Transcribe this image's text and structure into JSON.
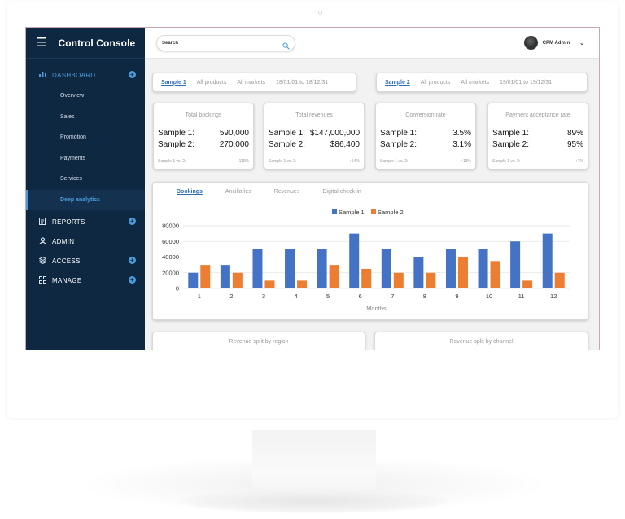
{
  "app": {
    "title": "Control Console"
  },
  "sidebar": {
    "sections": [
      {
        "label": "DASHBOARD",
        "icon": "bar-chart-icon",
        "active": true,
        "expand": true
      },
      {
        "label": "REPORTS",
        "icon": "document-icon",
        "active": false,
        "expand": true
      },
      {
        "label": "ADMIN",
        "icon": "user-icon",
        "active": false,
        "expand": false
      },
      {
        "label": "ACCESS",
        "icon": "layers-icon",
        "active": false,
        "expand": true
      },
      {
        "label": "MANAGE",
        "icon": "grid-icon",
        "active": false,
        "expand": true
      }
    ],
    "dashboard_items": [
      "Overview",
      "Sales",
      "Promotion",
      "Payments",
      "Services",
      "Deep analytics"
    ],
    "active_item": "Deep analytics"
  },
  "topbar": {
    "search_placeholder": "Search",
    "user_name": "CPM Admin"
  },
  "filters": [
    {
      "sample": "Sample 1",
      "products": "All products",
      "markets": "All markets",
      "range": "18/01/01 to 18/12/31"
    },
    {
      "sample": "Sample 2",
      "products": "All products",
      "markets": "All markets",
      "range": "19/01/01 to 19/12/31"
    }
  ],
  "kpis": [
    {
      "title": "Total bookings",
      "s1_label": "Sample 1:",
      "s1": "590,000",
      "s2_label": "Sample 2:",
      "s2": "270,000",
      "cmp_label": "Sample 1 vs. 2:",
      "cmp": "+119%"
    },
    {
      "title": "Total revenues",
      "s1_label": "Sample 1:",
      "s1": "$147,000,000",
      "s2_label": "Sample 2:",
      "s2": "$86,400",
      "cmp_label": "Sample 1 vs. 2:",
      "cmp": "+54%"
    },
    {
      "title": "Conversion rate",
      "s1_label": "Sample 1:",
      "s1": "3.5%",
      "s2_label": "Sample 2:",
      "s2": "3.1%",
      "cmp_label": "Sample 1 vs. 2:",
      "cmp": "+13%"
    },
    {
      "title": "Payment acceptance rate",
      "s1_label": "Sample 1:",
      "s1": "89%",
      "s2_label": "Sample 2:",
      "s2": "95%",
      "cmp_label": "Sample 1 vs. 2:",
      "cmp": "+7%"
    }
  ],
  "chart_tabs": [
    "Bookings",
    "Ancillaries",
    "Revenues",
    "Digital check-in"
  ],
  "active_tab": "Bookings",
  "chart_data": {
    "type": "bar",
    "categories": [
      "1",
      "2",
      "3",
      "4",
      "5",
      "6",
      "7",
      "8",
      "9",
      "10",
      "11",
      "12"
    ],
    "series": [
      {
        "name": "Sample 1",
        "color": "#4472c4",
        "values": [
          20000,
          30000,
          50000,
          50000,
          50000,
          70000,
          50000,
          40000,
          50000,
          50000,
          60000,
          70000
        ]
      },
      {
        "name": "Sample 2",
        "color": "#ed7d31",
        "values": [
          30000,
          20000,
          10000,
          10000,
          30000,
          25000,
          20000,
          20000,
          40000,
          35000,
          10000,
          20000
        ]
      }
    ],
    "xlabel": "Months",
    "ylabel": "",
    "ylim": [
      0,
      80000
    ],
    "yticks": [
      0,
      20000,
      40000,
      60000,
      80000
    ],
    "grid": true,
    "legend": "top-center"
  },
  "split_cards": [
    "Revenue split by region",
    "Revenue split by channel"
  ]
}
